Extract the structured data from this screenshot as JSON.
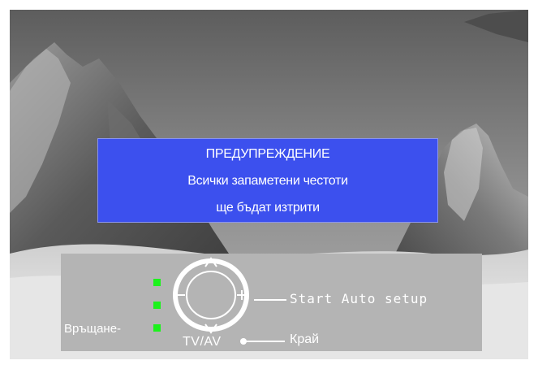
{
  "warning": {
    "title": "ПРЕДУПРЕЖДЕНИЕ",
    "line1": "Всички запаметени честоти",
    "line2": "ще бъдат изтрити"
  },
  "controls": {
    "return_label": "Връщане-",
    "start_label": "Start Auto setup",
    "tvav_label": "TV/AV",
    "exit_label": "Край",
    "joystick": {
      "up": "^",
      "down": "v",
      "minus": "−",
      "plus": "+"
    }
  },
  "colors": {
    "dialog_background": "#3c50ee",
    "panel_background": "#b4b4b4",
    "led": "#1cf21c",
    "text": "#ffffff"
  },
  "icons": [
    "joystick-icon",
    "led-indicator"
  ]
}
